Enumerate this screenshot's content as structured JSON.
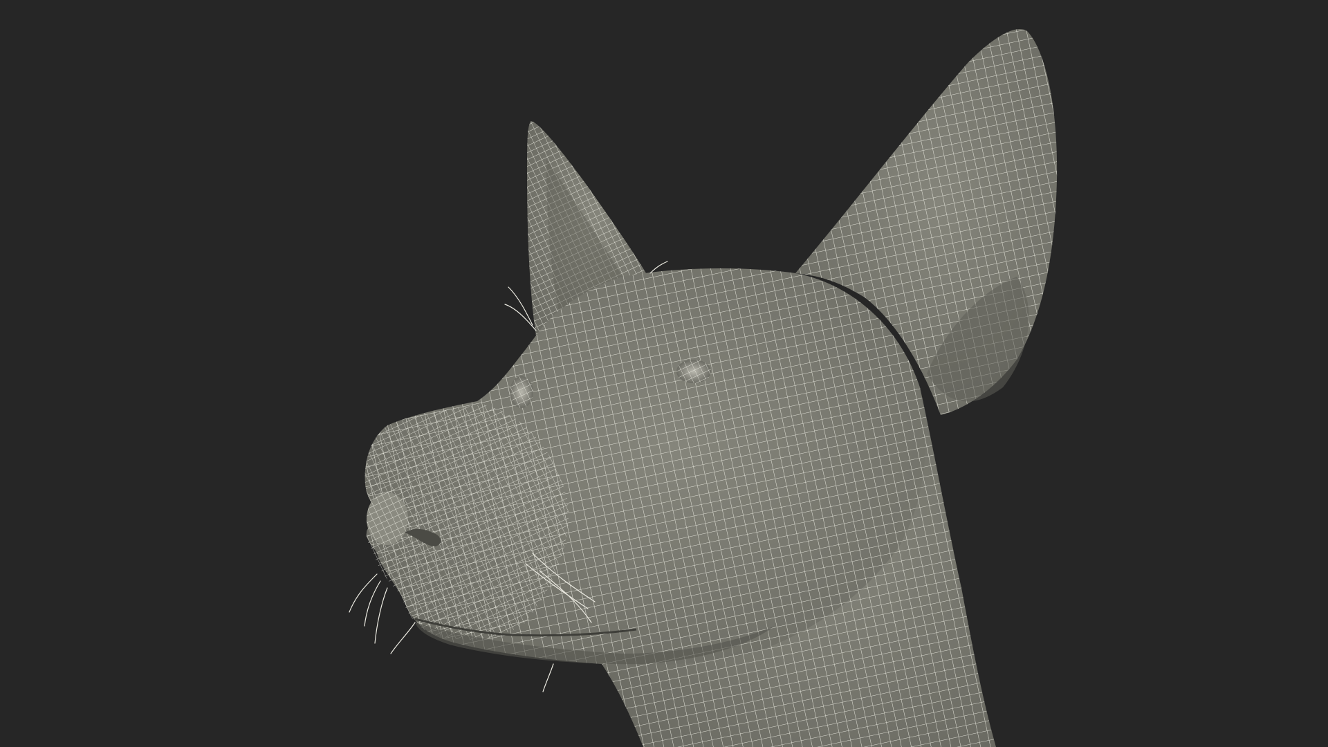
{
  "scene": {
    "subject": "dog-head-wireframe",
    "background_color": "#262626",
    "mesh_fill_color": "#7b7b71",
    "mesh_shade_color": "#5f5f57",
    "wire_color": "#ecebe2"
  }
}
